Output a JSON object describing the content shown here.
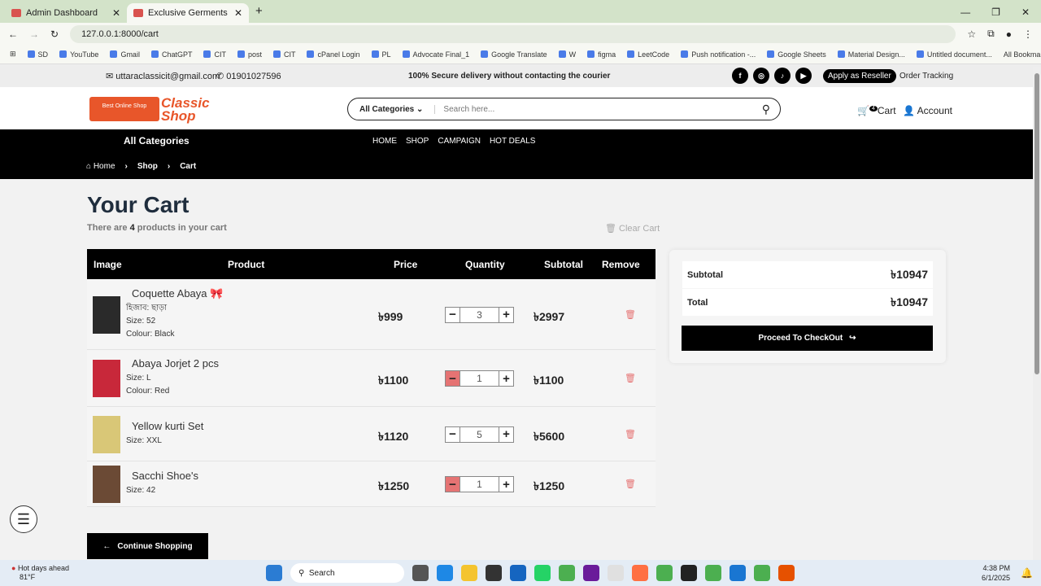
{
  "browser": {
    "tabs": [
      {
        "label": "Admin Dashboard"
      },
      {
        "label": "Exclusive Germents"
      }
    ],
    "url": "127.0.0.1:8000/cart",
    "bookmarks": [
      "SD",
      "YouTube",
      "Gmail",
      "ChatGPT",
      "CIT",
      "post",
      "CIT",
      "cPanel Login",
      "PL",
      "Advocate Final_1",
      "Google Translate",
      "W",
      "figma",
      "LeetCode",
      "Push notification -...",
      "Google Sheets",
      "Material Design...",
      "Untitled document..."
    ],
    "all_bookmarks": "All Bookmarks"
  },
  "topbar": {
    "email": "uttaraclassicit@gmail.com",
    "phone": "01901027596",
    "notice": "100% Secure delivery without contacting the courier",
    "reseller": "Apply as Reseller",
    "tracking": "Order Tracking"
  },
  "header": {
    "logo_text": "Classic Shop",
    "logo_sub": "Best Online Shop",
    "category_select": "All Categories",
    "search_placeholder": "Search here...",
    "cart_count": "4",
    "cart_label": "Cart",
    "account_label": "Account"
  },
  "nav": {
    "all_categories": "All Categories",
    "links": [
      "HOME",
      "SHOP",
      "CAMPAIGN",
      "HOT DEALS"
    ],
    "breadcrumb": [
      "Home",
      "Shop",
      "Cart"
    ]
  },
  "cart": {
    "title": "Your Cart",
    "count_pre": "There are ",
    "count": "4",
    "count_post": " products in your cart",
    "clear": "Clear Cart",
    "headers": [
      "Image",
      "Product",
      "Price",
      "Quantity",
      "Subtotal",
      "Remove"
    ],
    "items": [
      {
        "name": "Coquette Abaya 🎀",
        "meta": [
          "হিজাব: ছাড়া",
          "Size: 52",
          "Colour: Black"
        ],
        "price": "৳999",
        "qty": "3",
        "subtotal": "৳2997",
        "img": "#2a2a2a"
      },
      {
        "name": "Abaya Jorjet 2 pcs",
        "meta": [
          "Size: L",
          "Colour: Red"
        ],
        "price": "৳1100",
        "qty": "1",
        "subtotal": "৳1100",
        "img": "#c8283a"
      },
      {
        "name": "Yellow kurti Set",
        "meta": [
          "Size: XXL"
        ],
        "price": "৳1120",
        "qty": "5",
        "subtotal": "৳5600",
        "img": "#d9c777"
      },
      {
        "name": "Sacchi Shoe's",
        "meta": [
          "Size: 42"
        ],
        "price": "৳1250",
        "qty": "1",
        "subtotal": "৳1250",
        "img": "#6b4a35"
      }
    ],
    "continue": "Continue Shopping"
  },
  "summary": {
    "subtotal_label": "Subtotal",
    "subtotal": "৳10947",
    "total_label": "Total",
    "total": "৳10947",
    "checkout": "Proceed To CheckOut"
  },
  "taskbar": {
    "weather": "Hot days ahead",
    "temp": "81°F",
    "search": "Search",
    "time": "4:38 PM",
    "date": "6/1/2025"
  }
}
